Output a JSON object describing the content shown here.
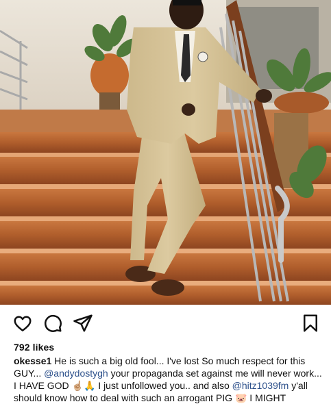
{
  "post": {
    "likes": "792 likes",
    "caption": {
      "username": "okesse1",
      "part1": " He is such a big old fool... I've lost So much respect for this GUY... ",
      "mention1": "@andydostygh",
      "part2": " your propaganda set against me will never work... I HAVE GOD ☝🏼🙏 I just unfollowed you.. and also ",
      "mention2": "@hitz1039fm",
      "part3": " y'all should know how to deal with such an arrogant PIG 🐷 I MIGHT"
    }
  },
  "actions": {
    "like_icon": "heart-icon",
    "comment_icon": "comment-icon",
    "share_icon": "send-icon",
    "save_icon": "bookmark-icon"
  },
  "colors": {
    "mention": "#2b4f8a",
    "text": "#111111",
    "background": "#ffffff"
  }
}
